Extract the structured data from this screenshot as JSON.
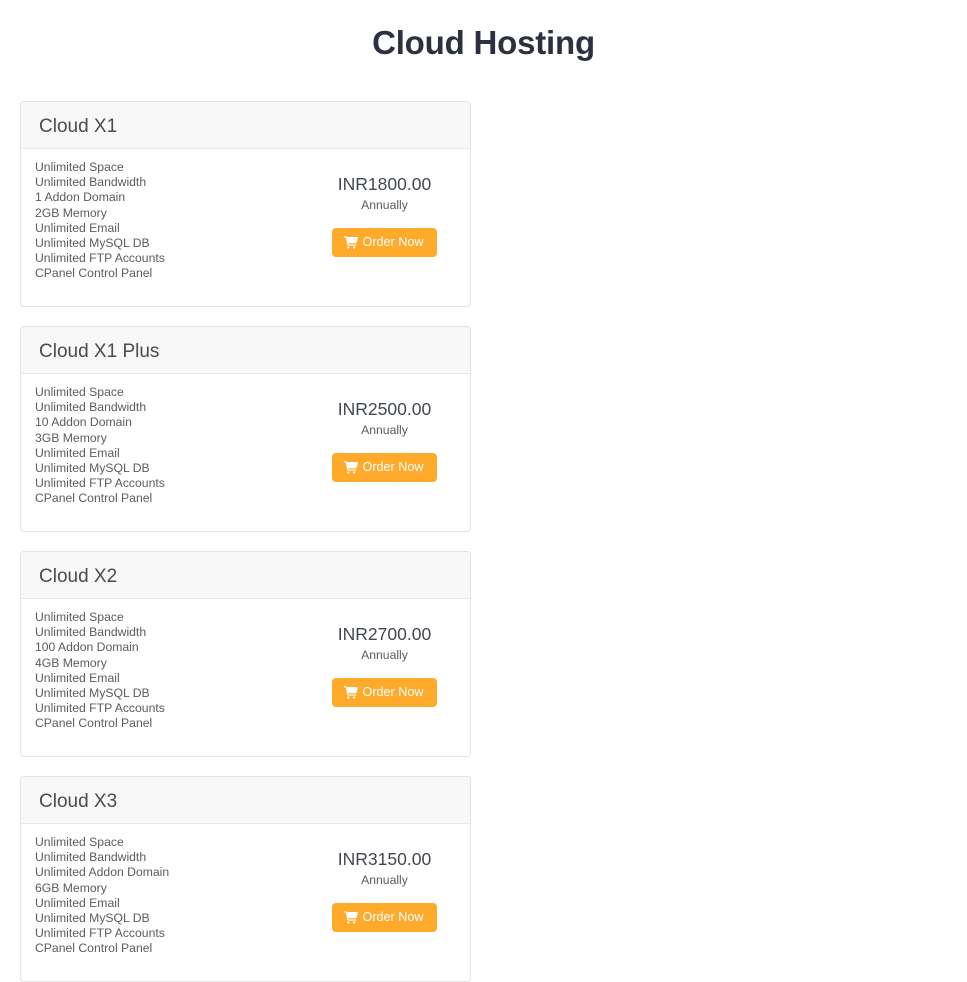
{
  "page": {
    "title": "Cloud Hosting"
  },
  "theme": {
    "accent": "#ffaa2b",
    "title_color": "#2c3040",
    "card_header_bg": "#f8f8f8",
    "card_border": "#e3e3e3",
    "text_color": "#5c5c5c",
    "button_text_color": "#ffffff",
    "page_bg": "#ffffff"
  },
  "order_button": {
    "label": "Order Now",
    "icon": "shopping-cart-icon"
  },
  "plans": [
    {
      "name": "Cloud X1",
      "features": [
        "Unlimited Space",
        "Unlimited Bandwidth",
        "1 Addon Domain",
        "2GB Memory",
        "Unlimited Email",
        "Unlimited MySQL DB",
        "Unlimited FTP Accounts",
        "CPanel Control Panel"
      ],
      "price": "INR1800.00",
      "cycle": "Annually",
      "button_label": "Order Now"
    },
    {
      "name": "Cloud X1 Plus",
      "features": [
        "Unlimited Space",
        "Unlimited Bandwidth",
        "10 Addon Domain",
        "3GB Memory",
        "Unlimited Email",
        "Unlimited MySQL DB",
        "Unlimited FTP Accounts",
        "CPanel Control Panel"
      ],
      "price": "INR2500.00",
      "cycle": "Annually",
      "button_label": "Order Now"
    },
    {
      "name": "Cloud X2",
      "features": [
        "Unlimited Space",
        "Unlimited Bandwidth",
        "100 Addon Domain",
        "4GB Memory",
        "Unlimited Email",
        "Unlimited MySQL DB",
        "Unlimited FTP Accounts",
        "CPanel Control Panel"
      ],
      "price": "INR2700.00",
      "cycle": "Annually",
      "button_label": "Order Now"
    },
    {
      "name": "Cloud X3",
      "features": [
        "Unlimited Space",
        "Unlimited Bandwidth",
        "Unlimited Addon Domain",
        "6GB Memory",
        "Unlimited Email",
        "Unlimited MySQL DB",
        "Unlimited FTP Accounts",
        "CPanel Control Panel"
      ],
      "price": "INR3150.00",
      "cycle": "Annually",
      "button_label": "Order Now"
    }
  ]
}
